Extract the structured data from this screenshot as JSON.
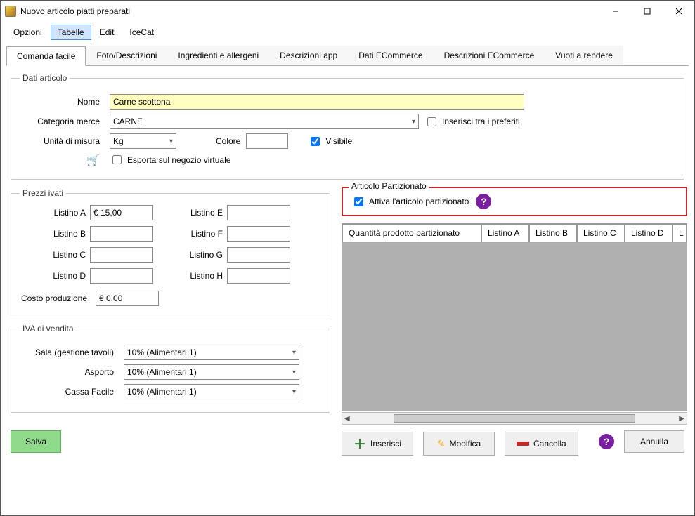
{
  "window": {
    "title": "Nuovo articolo piatti preparati"
  },
  "menu": {
    "opzioni": "Opzioni",
    "tabelle": "Tabelle",
    "edit": "Edit",
    "icecat": "IceCat"
  },
  "tabs": {
    "comanda": "Comanda facile",
    "foto": "Foto/Descrizioni",
    "ingredienti": "Ingredienti e allergeni",
    "descapp": "Descrizioni app",
    "datiec": "Dati ECommerce",
    "descec": "Descrizioni ECommerce",
    "vuoti": "Vuoti a rendere"
  },
  "dati_articolo": {
    "legend": "Dati articolo",
    "nome_label": "Nome",
    "nome_value": "Carne scottona",
    "categoria_label": "Categoria merce",
    "categoria_value": "CARNE",
    "preferiti_label": "Inserisci tra i preferiti",
    "preferiti_checked": false,
    "um_label": "Unità di misura",
    "um_value": "Kg",
    "colore_label": "Colore",
    "colore_value": "",
    "visibile_label": "Visibile",
    "visibile_checked": true,
    "esporta_label": "Esporta sul negozio virtuale",
    "esporta_checked": false
  },
  "prezzi": {
    "legend": "Prezzi ivati",
    "listino_a_label": "Listino A",
    "listino_a_value": "€ 15,00",
    "listino_b_label": "Listino B",
    "listino_b_value": "",
    "listino_c_label": "Listino C",
    "listino_c_value": "",
    "listino_d_label": "Listino D",
    "listino_d_value": "",
    "listino_e_label": "Listino E",
    "listino_e_value": "",
    "listino_f_label": "Listino F",
    "listino_f_value": "",
    "listino_g_label": "Listino G",
    "listino_g_value": "",
    "listino_h_label": "Listino H",
    "listino_h_value": "",
    "costo_label": "Costo produzione",
    "costo_value": "€ 0,00"
  },
  "iva": {
    "legend": "IVA di vendita",
    "sala_label": "Sala (gestione tavoli)",
    "sala_value": "10% (Alimentari 1)",
    "asporto_label": "Asporto",
    "asporto_value": "10% (Alimentari 1)",
    "cassa_label": "Cassa Facile",
    "cassa_value": "10% (Alimentari 1)"
  },
  "partizionato": {
    "legend": "Articolo Partizionato",
    "attiva_label": "Attiva l'articolo partizionato",
    "attiva_checked": true,
    "col_qta": "Quantità prodotto partizionato",
    "col_a": "Listino A",
    "col_b": "Listino B",
    "col_c": "Listino C",
    "col_d": "Listino D",
    "col_ext": "L",
    "btn_inserisci": "Inserisci",
    "btn_modifica": "Modifica",
    "btn_cancella": "Cancella"
  },
  "footer": {
    "salva": "Salva",
    "annulla": "Annulla"
  }
}
